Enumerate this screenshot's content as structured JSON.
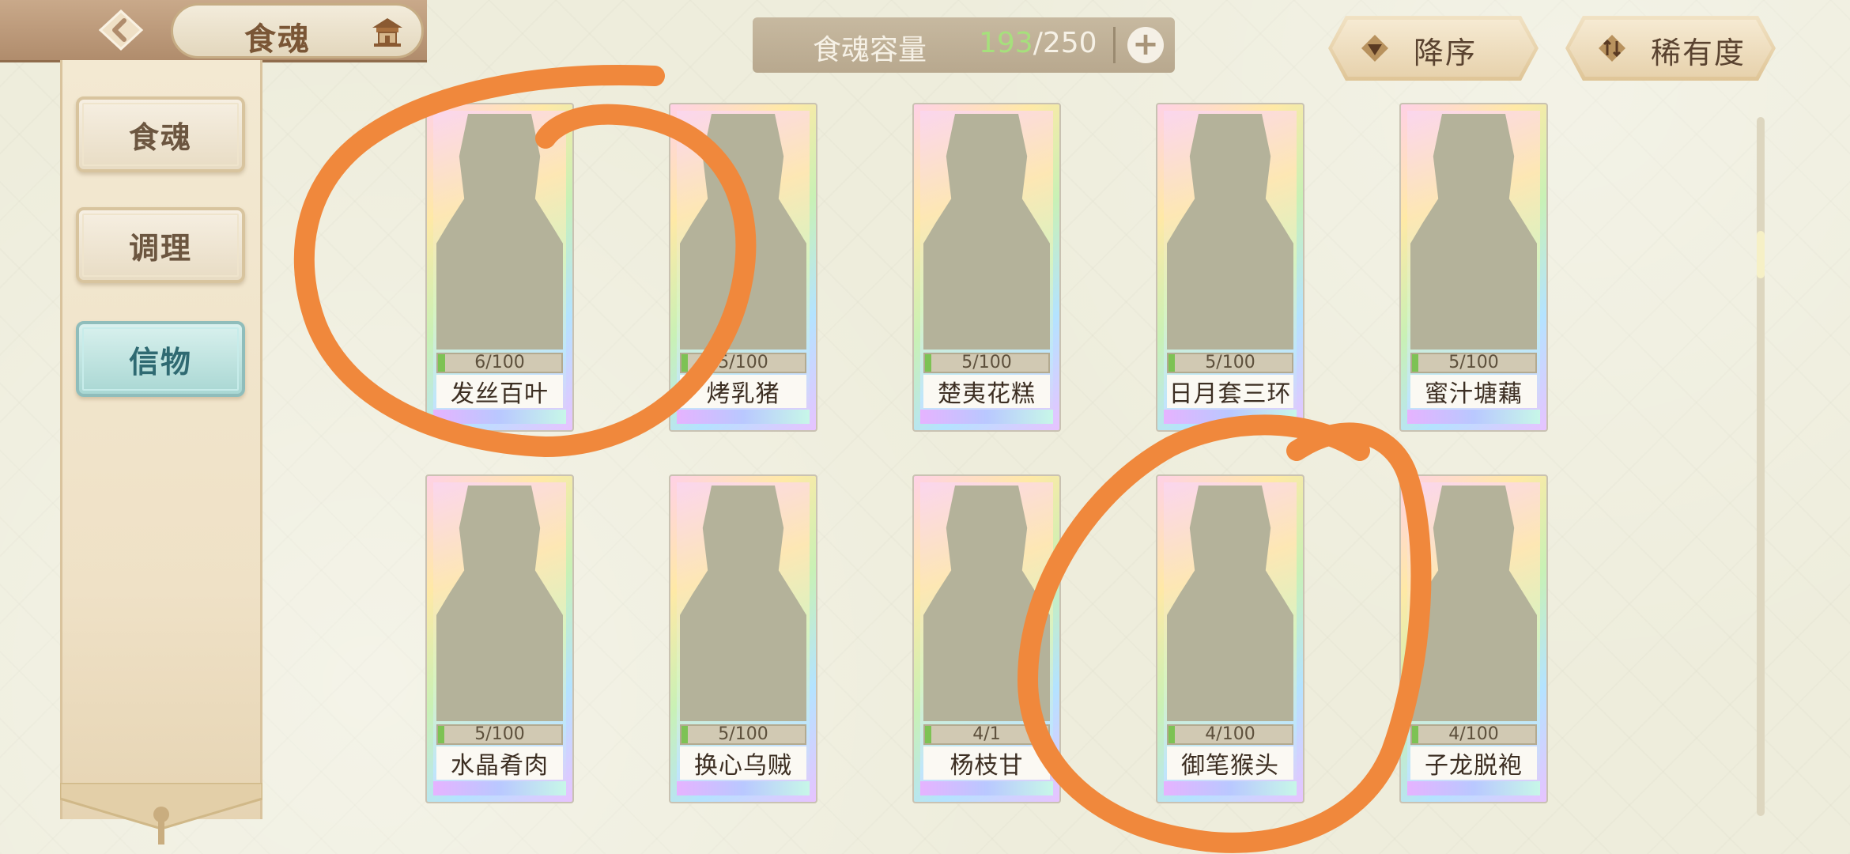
{
  "header": {
    "title": "食魂",
    "back_icon": "back-arrow-icon",
    "home_icon": "pavilion-icon"
  },
  "sidebar": {
    "items": [
      {
        "label": "食魂",
        "active": false
      },
      {
        "label": "调理",
        "active": false
      },
      {
        "label": "信物",
        "active": true
      }
    ]
  },
  "capacity": {
    "label": "食魂容量",
    "current": "193",
    "max": "/250",
    "plus": "+"
  },
  "sort": {
    "order_label": "降序",
    "rarity_label": "稀有度"
  },
  "cards": [
    {
      "name": "发丝百叶",
      "progress_text": "6/100",
      "progress": 0.06
    },
    {
      "name": "烤乳猪",
      "progress_text": "5/100",
      "progress": 0.05
    },
    {
      "name": "楚夷花糕",
      "progress_text": "5/100",
      "progress": 0.05
    },
    {
      "name": "日月套三环",
      "progress_text": "5/100",
      "progress": 0.05
    },
    {
      "name": "蜜汁塘藕",
      "progress_text": "5/100",
      "progress": 0.05
    },
    {
      "name": "水晶肴肉",
      "progress_text": "5/100",
      "progress": 0.05
    },
    {
      "name": "换心乌贼",
      "progress_text": "5/100",
      "progress": 0.05
    },
    {
      "name": "杨枝甘",
      "progress_text": "4/1",
      "progress": 0.04
    },
    {
      "name": "御笔猴头",
      "progress_text": "4/100",
      "progress": 0.04
    },
    {
      "name": "子龙脱袍",
      "progress_text": "4/100",
      "progress": 0.04
    }
  ],
  "colors": {
    "annotation": "#f0883c",
    "progress_fill": "#7dc254",
    "capacity_current": "#a6e07c"
  }
}
